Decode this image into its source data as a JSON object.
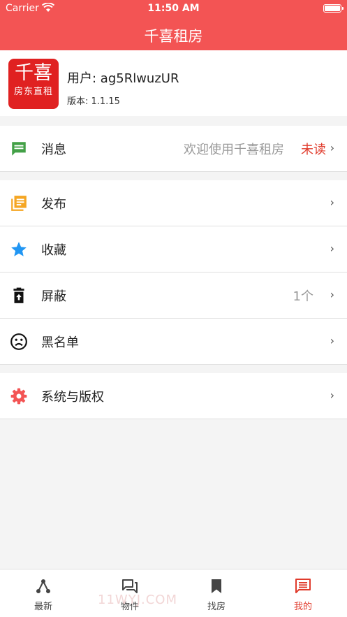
{
  "status": {
    "carrier": "Carrier",
    "time": "11:50 AM"
  },
  "header": {
    "title": "千喜租房"
  },
  "profile": {
    "logo_big": "千喜",
    "logo_small": "房东直租",
    "user": "用户: ag5RlwuzUR",
    "version": "版本: 1.1.15"
  },
  "menu": {
    "message": {
      "label": "消息",
      "detail": "欢迎使用千喜租房",
      "badge": "未读"
    },
    "publish": {
      "label": "发布"
    },
    "favorite": {
      "label": "收藏"
    },
    "block": {
      "label": "屏蔽",
      "count": "1个"
    },
    "blacklist": {
      "label": "黑名单"
    },
    "system": {
      "label": "系统与版权"
    }
  },
  "tabs": [
    {
      "label": "最新",
      "icon": "share-network-icon"
    },
    {
      "label": "物件",
      "icon": "chat-bubbles-icon"
    },
    {
      "label": "找房",
      "icon": "bookmark-icon"
    },
    {
      "label": "我的",
      "icon": "message-square-icon"
    }
  ],
  "chevron": "›",
  "watermark": "11WYJ.COM",
  "colors": {
    "header": "#f35454",
    "accent": "#e03b2c",
    "message_icon": "#43a047",
    "publish_icon": "#f5a623",
    "favorite_icon": "#2196f3",
    "settings_icon": "#f35454"
  }
}
